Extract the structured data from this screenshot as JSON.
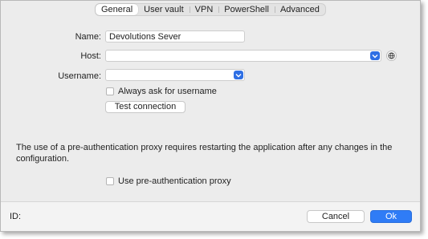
{
  "tabs": [
    {
      "label": "General",
      "active": true
    },
    {
      "label": "User vault",
      "active": false
    },
    {
      "label": "VPN",
      "active": false
    },
    {
      "label": "PowerShell",
      "active": false
    },
    {
      "label": "Advanced",
      "active": false
    }
  ],
  "form": {
    "name_label": "Name:",
    "name_value": "Devolutions Sever",
    "host_label": "Host:",
    "host_value": "",
    "username_label": "Username:",
    "username_value": "",
    "always_ask_label": "Always ask for username",
    "always_ask_checked": false,
    "test_connection_label": "Test connection"
  },
  "proxy": {
    "note": "The use of a pre-authentication proxy requires restarting the application after any changes in the configuration.",
    "use_proxy_label": "Use pre-authentication proxy",
    "use_proxy_checked": false
  },
  "footer": {
    "id_label": "ID:",
    "cancel_label": "Cancel",
    "ok_label": "Ok"
  },
  "colors": {
    "accent": "#2f7cf6",
    "window_bg": "#ececec"
  },
  "icons": {
    "dropdown": "chevron-down-icon",
    "globe": "globe-icon"
  }
}
